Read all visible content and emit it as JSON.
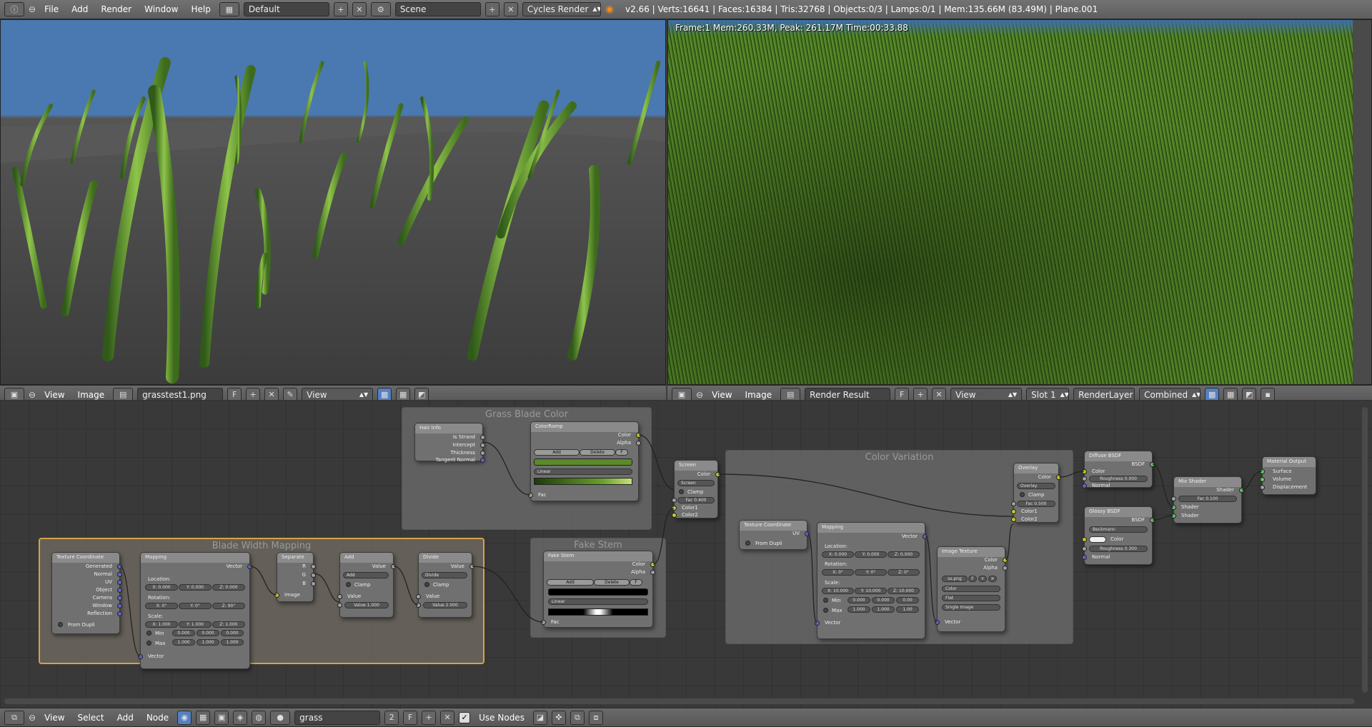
{
  "top_bar": {
    "info_icon": "info-icon",
    "menus": [
      "File",
      "Add",
      "Render",
      "Window",
      "Help"
    ],
    "layout": "Default",
    "scene": "Scene",
    "engine": "Cycles Render",
    "stats": "v2.66 | Verts:16641 | Faces:16384 | Tris:32768 | Objects:0/3 | Lamps:0/1 | Mem:135.66M (83.49M) | Plane.001"
  },
  "left_viewer": {
    "menus": [
      "View",
      "Image"
    ],
    "image_name": "grasstest1.png",
    "fake_user": "F",
    "display": "View"
  },
  "right_viewer": {
    "render_info": "Frame:1 Mem:260.33M, Peak: 261.17M Time:00:33.88",
    "menus": [
      "View",
      "Image"
    ],
    "image_name": "Render Result",
    "fake_user": "F",
    "display": "View",
    "slot": "Slot 1",
    "layer": "RenderLayer",
    "pass": "Combined"
  },
  "node_editor": {
    "frames": {
      "grass_blade_color": "Grass Blade Color",
      "blade_width_mapping": "Blade Width Mapping",
      "fake_stem": "Fake Stem",
      "color_variation": "Color Variation"
    },
    "hair_info": {
      "title": "Hair Info",
      "outputs": [
        "Is Strand",
        "Intercept",
        "Thickness",
        "Tangent Normal"
      ]
    },
    "colorramp1": {
      "title": "ColorRamp",
      "outputs": [
        "Color",
        "Alpha"
      ],
      "add": "Add",
      "delete": "Delete",
      "f": "F",
      "interp": "Linear",
      "input": "Fac"
    },
    "screen_node": {
      "title": "Screen",
      "output": "Color",
      "mode": "Screen",
      "clamp": "Clamp",
      "fac": "Fac 0.400",
      "inputs": [
        "Color1",
        "Color2"
      ]
    },
    "tex_coord1": {
      "title": "Texture Coordinate",
      "outputs": [
        "Generated",
        "Normal",
        "UV",
        "Object",
        "Camera",
        "Window",
        "Reflection"
      ],
      "from_dupli": "From Dupli"
    },
    "mapping1": {
      "title": "Mapping",
      "output": "Vector",
      "location": "Location:",
      "loc": [
        "X: 0.000",
        "Y: 0.000",
        "Z: 0.000"
      ],
      "rotation": "Rotation:",
      "rot": [
        "X: 0°",
        "Y: 0°",
        "Z: 90°"
      ],
      "scale": "Scale:",
      "scl": [
        "X: 1.000",
        "Y: 1.000",
        "Z: 1.000"
      ],
      "min": "Min",
      "max": "Max",
      "minv": [
        "0.000",
        "0.000",
        "0.000"
      ],
      "maxv": [
        "1.000",
        "1.000",
        "1.000"
      ],
      "input": "Vector"
    },
    "separate": {
      "title": "Separate",
      "outputs": [
        "R",
        "G",
        "B"
      ],
      "input": "Image"
    },
    "add_node": {
      "title": "Add",
      "output": "Value",
      "mode": "Add",
      "clamp": "Clamp",
      "input": "Value",
      "value": "Value 1.000"
    },
    "divide_node": {
      "title": "Divide",
      "output": "Value",
      "mode": "Divide",
      "clamp": "Clamp",
      "input": "Value",
      "value": "Value 2.000"
    },
    "colorramp2": {
      "title": "Fake Stem",
      "outputs": [
        "Color",
        "Alpha"
      ],
      "add": "Add",
      "delete": "Delete",
      "f": "F",
      "interp": "Linear",
      "input": "Fac"
    },
    "tex_coord2": {
      "title": "Texture Coordinate",
      "output": "UV",
      "from_dupli": "From Dupli"
    },
    "mapping2": {
      "title": "Mapping",
      "output": "Vector",
      "location": "Location:",
      "loc": [
        "X: 0.000",
        "Y: 0.000",
        "Z: 0.000"
      ],
      "rotation": "Rotation:",
      "rot": [
        "X: 0°",
        "Y: 0°",
        "Z: 0°"
      ],
      "scale": "Scale:",
      "scl": [
        "X: 10.000",
        "Y: 10.000",
        "Z: 10.000"
      ],
      "min": "Min",
      "max": "Max",
      "minv": [
        "0.000",
        "0.000",
        "0.00"
      ],
      "maxv": [
        "1.000",
        "1.000",
        "1.00"
      ],
      "input": "Vector"
    },
    "image_tex": {
      "title": "Image Texture",
      "outputs": [
        "Color",
        "Alpha"
      ],
      "file": "ss.png",
      "f": "F",
      "color": "Color",
      "proj": "Flat",
      "source": "Single Image",
      "input": "Vector"
    },
    "overlay": {
      "title": "Overlay",
      "output": "Color",
      "mode": "Overlay",
      "clamp": "Clamp",
      "fac": "Fac 0.500",
      "inputs": [
        "Color1",
        "Color2"
      ]
    },
    "diffuse": {
      "title": "Diffuse BSDF",
      "output": "BSDF",
      "color": "Color",
      "roughness": "Roughness 0.000",
      "normal": "Normal"
    },
    "glossy": {
      "title": "Glossy BSDF",
      "output": "BSDF",
      "dist": "Beckmann",
      "color": "Color",
      "roughness": "Roughness 0.300",
      "normal": "Normal"
    },
    "mix": {
      "title": "Mix Shader",
      "output": "Shader",
      "fac": "Fac 0.100",
      "inputs": [
        "Shader",
        "Shader"
      ]
    },
    "output": {
      "title": "Material Output",
      "inputs": [
        "Surface",
        "Volume",
        "Displacement"
      ]
    }
  },
  "bottom_bar": {
    "menus": [
      "View",
      "Select",
      "Add",
      "Node"
    ],
    "material": "grass",
    "users": "2",
    "fake_user": "F",
    "use_nodes": "Use Nodes"
  },
  "colors": {
    "accent": "#5680c2",
    "frame_selected": "#d6a14b",
    "sky": "#4a78b0",
    "grass": "#3f6b20"
  }
}
